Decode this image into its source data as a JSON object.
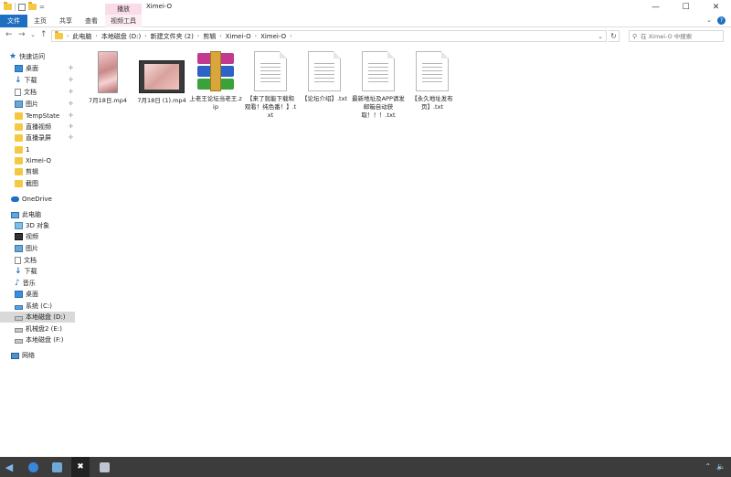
{
  "window": {
    "title": "Ximei-O",
    "context_tab": "播放",
    "minimize": "—",
    "maximize": "☐",
    "close": "✕"
  },
  "ribbon": {
    "tabs": [
      "文件",
      "主页",
      "共享",
      "查看",
      "视频工具"
    ],
    "expand": "⌄",
    "help": "?"
  },
  "nav": {
    "back": "←",
    "forward": "→",
    "recent": "⌄",
    "up": "↑"
  },
  "address": {
    "segments": [
      "此电脑",
      "本地磁盘 (D:)",
      "新建文件夹 (2)",
      "剪辑",
      "Ximei-O",
      "Ximei-O"
    ],
    "dropdown": "⌄",
    "refresh": "↻"
  },
  "search": {
    "placeholder": "在 Ximei-O 中搜索",
    "icon": "search-icon"
  },
  "sidebar": {
    "quick_access": "快速访问",
    "quick_items": [
      "桌面",
      "下载",
      "文档",
      "图片",
      "TempState",
      "直播视频",
      "直播录屏",
      "1",
      "Ximei-O",
      "剪辑",
      "截图"
    ],
    "onedrive": "OneDrive",
    "this_pc": "此电脑",
    "pc_items": [
      "3D 对象",
      "视频",
      "图片",
      "文档",
      "下载",
      "音乐",
      "桌面",
      "系统 (C:)",
      "本地磁盘 (D:)",
      "机械盘2 (E:)",
      "本地磁盘 (F:)"
    ],
    "network": "网络",
    "selected": "本地磁盘 (D:)"
  },
  "files": [
    {
      "name": "7月18日.mp4",
      "type": "video-portrait"
    },
    {
      "name": "7月18日 (1).mp4",
      "type": "video-landscape"
    },
    {
      "name": "上老王论坛当老王.zip",
      "type": "zip"
    },
    {
      "name": "【来了就能下载和观看！纯色番！】.txt",
      "type": "txt"
    },
    {
      "name": "【论坛介绍】.txt",
      "type": "txt"
    },
    {
      "name": "最新地址及APP请发邮箱自动获取！！！.txt",
      "type": "txt"
    },
    {
      "name": "【永久地址发布页】.txt",
      "type": "txt"
    }
  ],
  "taskbar": {
    "apps": [
      "start",
      "edge",
      "files",
      "capcut",
      "printer"
    ]
  },
  "colors": {
    "accent": "#1e6fc2",
    "context_tab": "#fadbe8",
    "folder": "#f5c842",
    "taskbar": "#3c3c3c",
    "selection": "#d9d9d9"
  }
}
